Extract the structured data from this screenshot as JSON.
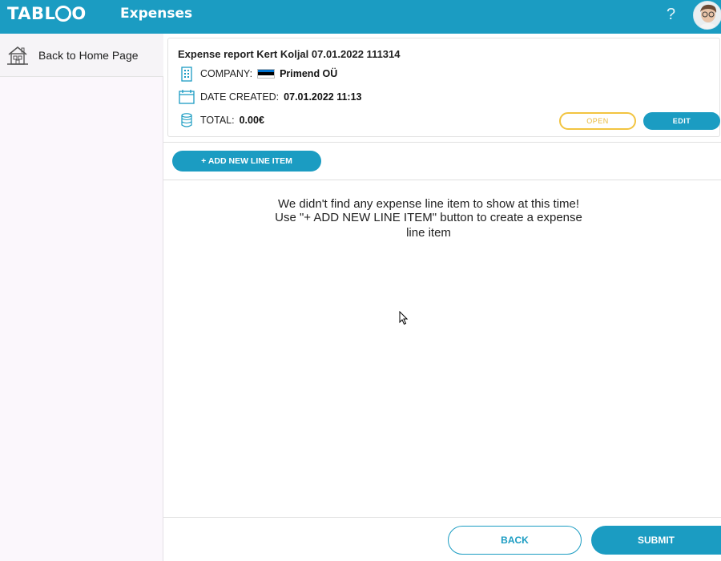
{
  "header": {
    "logo_text_left": "TABL",
    "logo_text_right": "O",
    "app_title": "Expenses",
    "help_label": "?"
  },
  "sidebar": {
    "back_home_label": "Back to Home Page"
  },
  "report": {
    "title": "Expense report Kert Koljal 07.01.2022 111314",
    "company_label": "COMPANY:",
    "company_value": "Primend OÜ",
    "date_label": "DATE CREATED:",
    "date_value": "07.01.2022 11:13",
    "total_label": "TOTAL:",
    "total_value": "0.00€",
    "status": "OPEN",
    "edit_label": "EDIT"
  },
  "toolbar": {
    "add_label": "+ ADD NEW LINE ITEM"
  },
  "empty_state": {
    "line1": "We didn't find any expense line item to show at this time!",
    "line2": "Use \"+ ADD NEW LINE ITEM\" button to create a expense",
    "line3": "line item"
  },
  "footer": {
    "back_label": "BACK",
    "submit_label": "SUBMIT"
  },
  "colors": {
    "brand": "#1b9cc2",
    "status_open": "#f2c440"
  }
}
